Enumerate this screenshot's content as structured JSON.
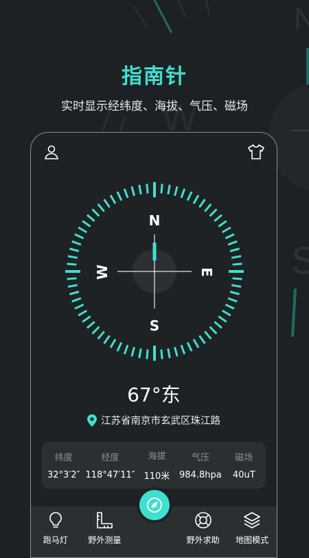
{
  "header": {
    "title": "指南针",
    "subtitle": "实时显示经纬度、海拔、气压、磁场"
  },
  "compass": {
    "north": "N",
    "east": "E",
    "south": "S",
    "west": "W",
    "heading_text": "67°东",
    "accent": "#3fe0cf"
  },
  "location": {
    "address": "江苏省南京市玄武区珠江路",
    "icon": "location-pin-icon"
  },
  "stats": [
    {
      "label": "纬度",
      "value": "32°3′2″"
    },
    {
      "label": "经度",
      "value": "118°47′11″"
    },
    {
      "label": "海拔",
      "value": "110米"
    },
    {
      "label": "气压",
      "value": "984.8hpa"
    },
    {
      "label": "磁场",
      "value": "40uT"
    }
  ],
  "nav": {
    "items": [
      {
        "label": "跑马灯",
        "icon": "lightbulb-icon"
      },
      {
        "label": "野外测量",
        "icon": "ruler-icon"
      },
      {
        "label": "野外求助",
        "icon": "lifebuoy-icon"
      },
      {
        "label": "地图模式",
        "icon": "layers-icon"
      }
    ],
    "center_icon": "compass-icon"
  },
  "colors": {
    "accent": "#3fe0cf",
    "background": "#1d2124",
    "panel": "#2a2f32"
  }
}
